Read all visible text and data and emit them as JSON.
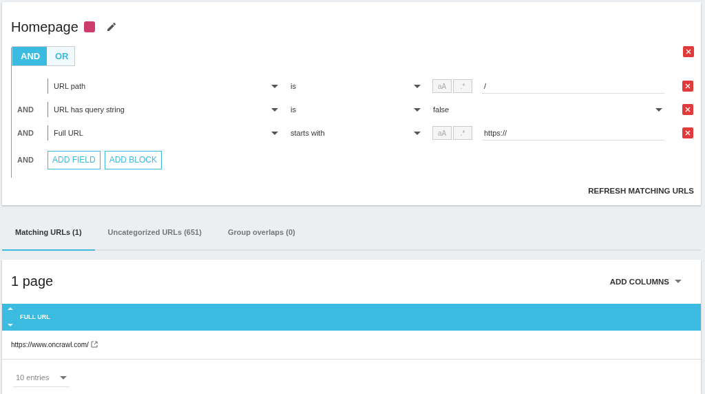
{
  "group": {
    "title": "Homepage",
    "color": "#cc3d6e"
  },
  "logic": [
    {
      "label": "AND",
      "selected": true
    },
    {
      "label": "OR",
      "selected": false
    }
  ],
  "rules": [
    {
      "field": "URL path",
      "operator": "is",
      "case_toggle": "aA",
      "regex_toggle": ".*",
      "kind": "text",
      "value": "/"
    },
    {
      "connector": "AND",
      "field": "URL has query string",
      "operator": "is",
      "kind": "select",
      "value": "false"
    },
    {
      "connector": "AND",
      "field": "Full URL",
      "operator": "starts with",
      "case_toggle": "aA",
      "regex_toggle": ".*",
      "kind": "text",
      "value": "https://"
    }
  ],
  "add_row": {
    "connector": "AND",
    "buttons": [
      "ADD FIELD",
      "ADD BLOCK"
    ]
  },
  "refresh_button": "REFRESH MATCHING URLS",
  "tabs": [
    {
      "label": "Matching URLs (1)",
      "selected": true
    },
    {
      "label": "Uncategorized URLs (651)",
      "selected": false
    },
    {
      "label": "Group overlaps (0)",
      "selected": false
    }
  ],
  "results": {
    "title": "1 page",
    "add_columns": "ADD COLUMNS",
    "columns": [
      "FULL URL"
    ],
    "rows": [
      [
        "https://www.oncrawl.com/"
      ]
    ],
    "page_size": "10 entries"
  }
}
